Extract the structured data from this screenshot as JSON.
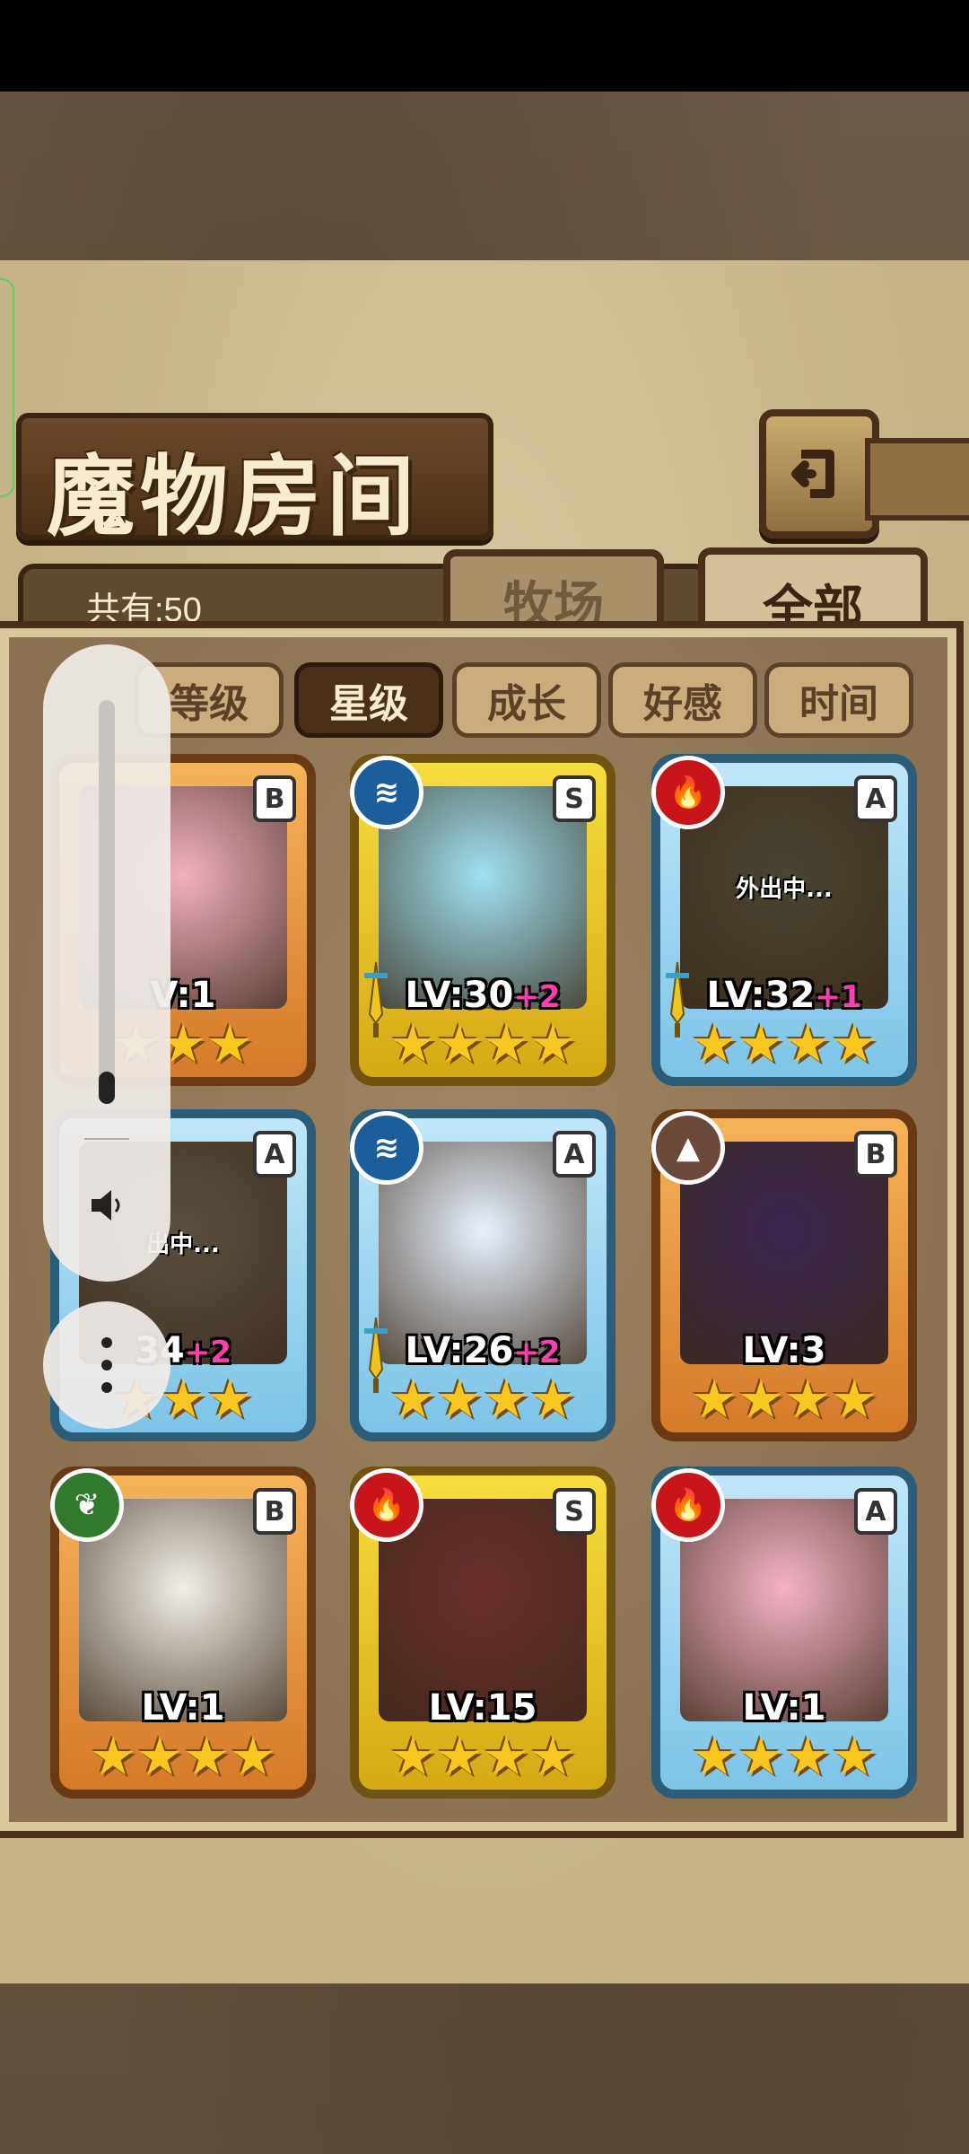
{
  "header": {
    "title": "魔物房间",
    "count_label": "共有:50"
  },
  "tabs": [
    {
      "label": "牧场",
      "active": false
    },
    {
      "label": "全部",
      "active": true
    }
  ],
  "sort_buttons": [
    {
      "label": "等级",
      "active": false
    },
    {
      "label": "星级",
      "active": true
    },
    {
      "label": "成长",
      "active": false
    },
    {
      "label": "好感",
      "active": false
    },
    {
      "label": "时间",
      "active": false
    }
  ],
  "monsters": [
    {
      "frame": "orange",
      "rank": "B",
      "element": "",
      "level": "V:1",
      "plus": "",
      "stars": "★★★",
      "status": "",
      "weapon": false,
      "portrait": "#f4b0c0"
    },
    {
      "frame": "gold",
      "rank": "S",
      "element": "water",
      "level": "LV:30",
      "plus": "+2",
      "stars": "★★★★",
      "status": "",
      "weapon": true,
      "portrait": "#9fe2f0"
    },
    {
      "frame": "blue",
      "rank": "A",
      "element": "fire",
      "level": "LV:32",
      "plus": "+1",
      "stars": "★★★★",
      "status": "外出中...",
      "weapon": true,
      "portrait": "#4a4432"
    },
    {
      "frame": "blue",
      "rank": "A",
      "element": "",
      "level": "34",
      "plus": "+2",
      "stars": "★★★",
      "status": "出中...",
      "weapon": false,
      "portrait": "#5a5040"
    },
    {
      "frame": "blue",
      "rank": "A",
      "element": "water",
      "level": "LV:26",
      "plus": "+2",
      "stars": "★★★★",
      "status": "",
      "weapon": true,
      "portrait": "#e8f2ff"
    },
    {
      "frame": "orange",
      "rank": "B",
      "element": "earth",
      "level": "LV:3",
      "plus": "",
      "stars": "★★★★",
      "status": "",
      "weapon": false,
      "portrait": "#3b2650"
    },
    {
      "frame": "orange",
      "rank": "B",
      "element": "wood",
      "level": "LV:1",
      "plus": "",
      "stars": "★★★★",
      "status": "",
      "weapon": false,
      "portrait": "#f2efe8"
    },
    {
      "frame": "gold",
      "rank": "S",
      "element": "fire",
      "level": "LV:15",
      "plus": "",
      "stars": "★★★★",
      "status": "",
      "weapon": false,
      "portrait": "#6b2d2d"
    },
    {
      "frame": "blue",
      "rank": "A",
      "element": "fire",
      "level": "LV:1",
      "plus": "",
      "stars": "★★★★",
      "status": "",
      "weapon": false,
      "portrait": "#f6b2c6"
    }
  ],
  "element_glyphs": {
    "water": "≋",
    "fire": "🔥",
    "earth": "▲",
    "wood": "❦"
  },
  "overlay": {
    "volume_level": 0.08
  }
}
